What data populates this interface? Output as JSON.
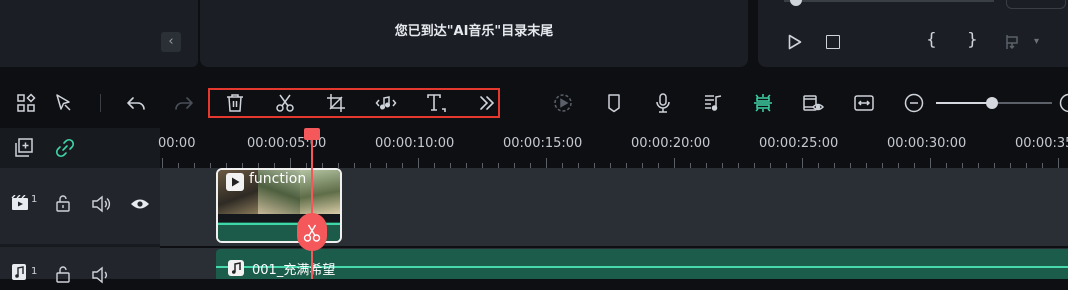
{
  "preview": {
    "end_message": "您已到达\"AI音乐\"目录末尾",
    "collapse_glyph": "‹",
    "brace_left": "{",
    "brace_right": "}"
  },
  "toolbar": {
    "icons": [
      "layout-icon",
      "select-icon",
      "undo-icon",
      "redo-icon",
      "delete-icon",
      "split-icon",
      "crop-icon",
      "audio-adjust-icon",
      "text-icon",
      "more-icon",
      "render-preview-icon",
      "marker-icon",
      "record-voice-icon",
      "music-beat-icon",
      "auto-snap-icon",
      "preview-quality-icon",
      "fit-timeline-icon",
      "zoom-out-icon"
    ],
    "zoom_level": 0.85,
    "highlight_color": "#e5382f"
  },
  "ruler": {
    "labels": [
      "00:00",
      "00:00:05:00",
      "00:00:10:00",
      "00:00:15:00",
      "00:00:20:00",
      "00:00:25:00",
      "00:00:30:00",
      "00:00:35"
    ]
  },
  "tracks": {
    "video": {
      "number": "1",
      "clip_title": "function"
    },
    "audio": {
      "number": "1",
      "clip_title": "001_充满希望"
    }
  },
  "colors": {
    "accent": "#3fd6a8",
    "playhead": "#f4585a",
    "panel": "#1b1f25"
  }
}
